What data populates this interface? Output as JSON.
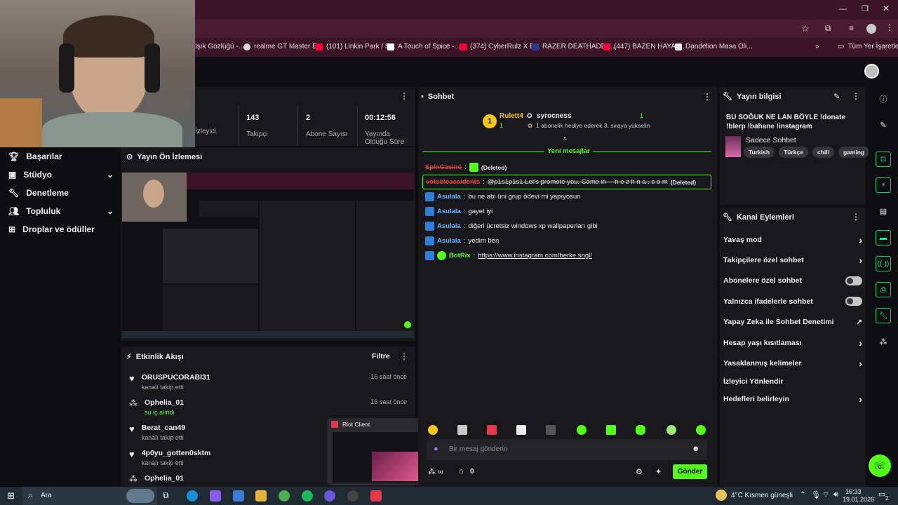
{
  "bookmarks": [
    {
      "label": "Işık Gözlüğü -..."
    },
    {
      "label": "realme GT Master E..."
    },
    {
      "label": "(101) Linkin Park / S..."
    },
    {
      "label": "A Touch of Spice -..."
    },
    {
      "label": "(374) CyberRulz X B..."
    },
    {
      "label": "RAZER DEATHADDE..."
    },
    {
      "label": "(447) BAZEN HAYAT..."
    },
    {
      "label": "Dandelion Masa Oli..."
    },
    {
      "label": "Tüm Yer İşaretleri"
    }
  ],
  "stats": {
    "viewers_label": "İzleyici",
    "followers": "143",
    "followers_label": "Takipçi",
    "subs": "2",
    "subs_label": "Abone Sayısı",
    "uptime": "00:12:56",
    "uptime_label": "Yayında Olduğu Süre"
  },
  "sidebar": {
    "items": [
      {
        "label": "Başarılar"
      },
      {
        "label": "Stüdyo"
      },
      {
        "label": "Denetleme"
      },
      {
        "label": "Topluluk"
      },
      {
        "label": "Droplar ve ödüller"
      }
    ]
  },
  "preview": {
    "title": "Yayın Ön İzlemesi"
  },
  "activity": {
    "title": "Etkinlik Akışı",
    "filter": "Filtre",
    "items": [
      {
        "name": "ORUSPUCORABI31",
        "sub": "kanalı takip etti",
        "time": "16 saat önce"
      },
      {
        "name": "Ophelia_01",
        "sub": "su iç alındı",
        "time": "16 saat önce"
      },
      {
        "name": "Berat_can49",
        "sub": "kanalı takip etti",
        "time": ""
      },
      {
        "name": "4p0yu_gotten0sktm",
        "sub": "kanalı takip etti",
        "time": ""
      },
      {
        "name": "Ophelia_01",
        "sub": "",
        "time": ""
      }
    ]
  },
  "chat": {
    "title": "Sohbet",
    "pinned_user": "Rulett4",
    "pinned_count": "1",
    "pinned_gifter": "syrocness",
    "pinned_gifter_count": "1",
    "pinned_text": "1 abonelik hediye ederek 3. sıraya yükselin",
    "new_messages": "Yeni mesajlar",
    "messages": [
      {
        "user": "SpinCasino",
        "text": "(Deleted)"
      },
      {
        "user": "volubleaccidents",
        "text": "@p1s1p1s1 Let's promote you. Come in ---n e z h n a . c o m",
        "suffix": "(Deleted)"
      },
      {
        "user": "Asulala",
        "text": "bu ne abi üni grup ödevi mi yapıyosun"
      },
      {
        "user": "Asulala",
        "text": "gayet iyi"
      },
      {
        "user": "Asulala",
        "text": "diğeri ücretsiz windows xp wallpaperları gibi"
      },
      {
        "user": "Asulala",
        "text": "yedim ben"
      },
      {
        "user": "BotRix",
        "text": "https://www.instagram.com/berke.sngl/"
      }
    ],
    "input_placeholder": "Bir mesaj gönderin",
    "points": "0",
    "send": "Gönder"
  },
  "stream_info": {
    "title": "Yayın bilgisi",
    "stream_title": "BU SOĞUK NE LAN BÖYLE !donate !blerp !bahane !instagram",
    "category": "Sadece Sohbet",
    "tags": [
      "Turkish",
      "Türkçe",
      "chill",
      "gaming"
    ]
  },
  "channel_actions": {
    "title": "Kanal Eylemleri",
    "items": [
      {
        "label": "Yavaş mod",
        "control": "chevron"
      },
      {
        "label": "Takipçilere özel sohbet",
        "control": "chevron"
      },
      {
        "label": "Abonelere özel sohbet",
        "control": "toggle"
      },
      {
        "label": "Yalnızca ifadelerle sohbet",
        "control": "toggle"
      },
      {
        "label": "Yapay Zeka ile Sohbet Denetimi",
        "control": "external"
      },
      {
        "label": "Hesap yaşı kısıtlaması",
        "control": "chevron"
      },
      {
        "label": "Yasaklanmış kelimeler",
        "control": "chevron"
      },
      {
        "label": "İzleyici Yönlendir",
        "control": "none"
      },
      {
        "label": "Hedefleri belirleyin",
        "control": "chevron"
      }
    ]
  },
  "riot_popup": {
    "title": "Riot Client"
  },
  "taskbar": {
    "search": "Ara",
    "weather": "4°C  Kısmen güneşli",
    "time": "16:33",
    "date": "19.01.2026",
    "notifications": "2"
  },
  "colors": {
    "accent": "#53fc18",
    "pin_gold": "#f5c518",
    "chrome_maroon": "#3b1527"
  }
}
